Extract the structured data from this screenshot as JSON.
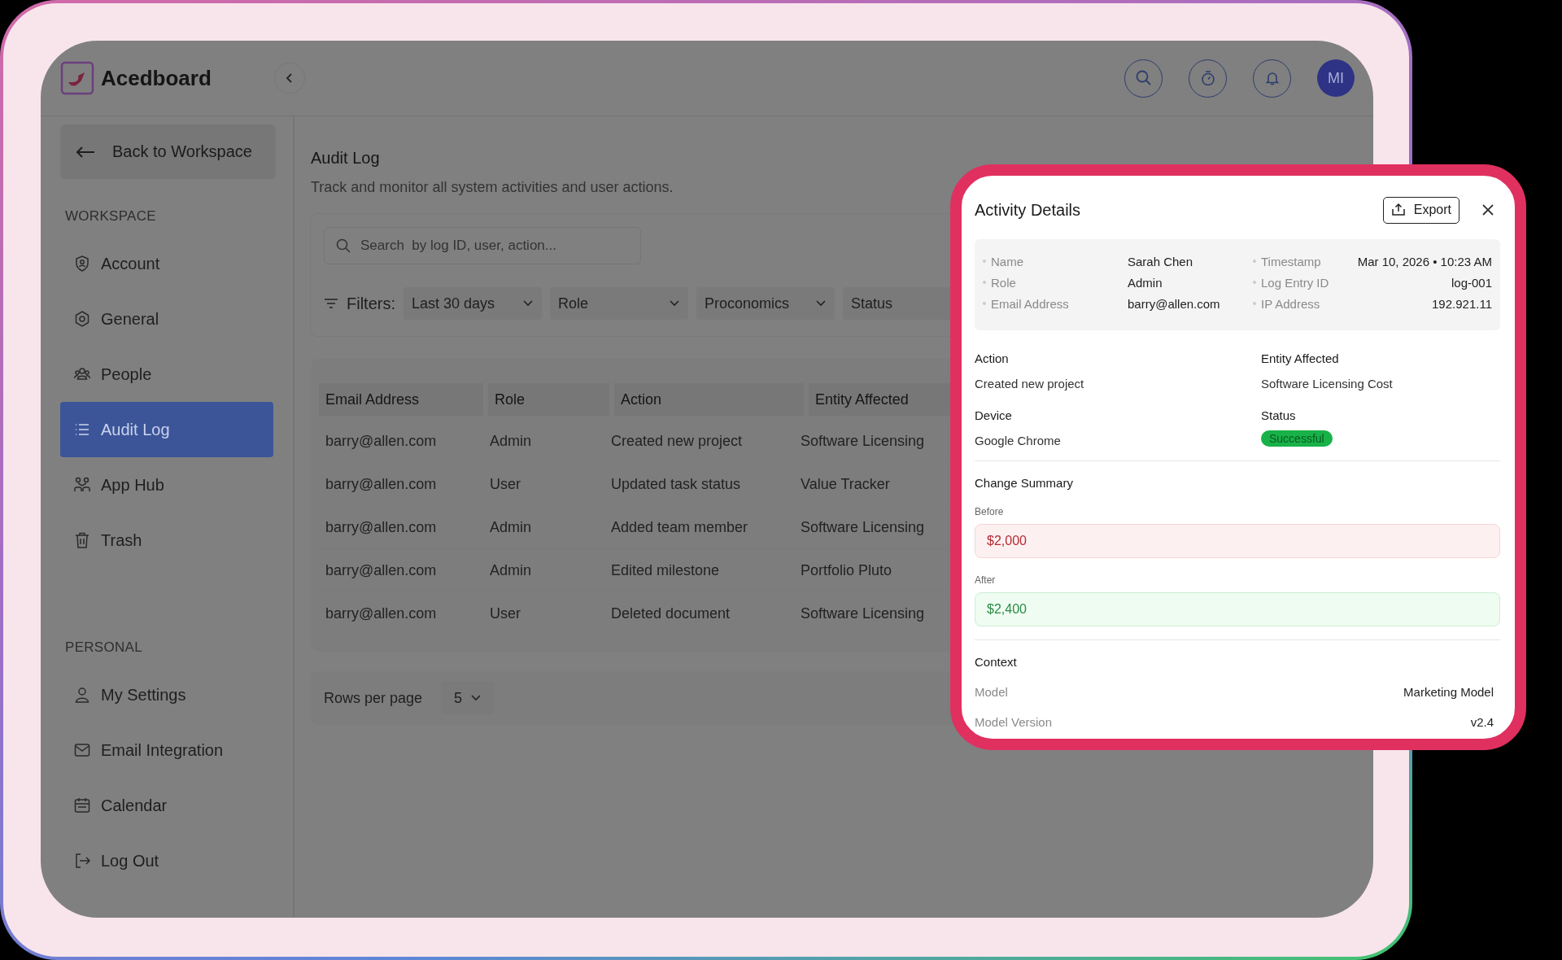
{
  "brand": {
    "name": "Acedboard"
  },
  "sidebar": {
    "back": "Back to Workspace",
    "sections": [
      {
        "title": "WORKSPACE",
        "items": [
          {
            "label": "Account",
            "kind": "shield",
            "selected": false
          },
          {
            "label": "General",
            "kind": "gear",
            "selected": false
          },
          {
            "label": "People",
            "kind": "people",
            "selected": false
          },
          {
            "label": "Audit Log",
            "kind": "list",
            "selected": true
          },
          {
            "label": "App Hub",
            "kind": "hub",
            "selected": false
          },
          {
            "label": "Trash",
            "kind": "trash",
            "selected": false
          }
        ]
      },
      {
        "title": "PERSONAL",
        "items": [
          {
            "label": "My Settings",
            "kind": "user",
            "selected": false
          },
          {
            "label": "Email Integration",
            "kind": "mail",
            "selected": false
          },
          {
            "label": "Calendar",
            "kind": "calendar",
            "selected": false
          },
          {
            "label": "Log Out",
            "kind": "logout",
            "selected": false
          }
        ]
      }
    ]
  },
  "header": {
    "avatar": "MI"
  },
  "page": {
    "title": "Audit Log",
    "subtitle": "Track and monitor all system activities and user actions.",
    "search": {
      "placeholder": "Search  by log ID, user, action..."
    },
    "filters_label": "Filters:",
    "filters": [
      "Last 30 days",
      "Role",
      "Proconomics",
      "Status"
    ]
  },
  "table": {
    "columns": [
      "Email Address",
      "Role",
      "Action",
      "Entity Affected"
    ],
    "rows": [
      [
        "barry@allen.com",
        "Admin",
        "Created new project",
        "Software Licensing"
      ],
      [
        "barry@allen.com",
        "User",
        "Updated task status",
        "Value Tracker"
      ],
      [
        "barry@allen.com",
        "Admin",
        "Added team member",
        "Software Licensing"
      ],
      [
        "barry@allen.com",
        "Admin",
        "Edited milestone",
        "Portfolio Pluto"
      ],
      [
        "barry@allen.com",
        "User",
        "Deleted document",
        "Software Licensing"
      ]
    ]
  },
  "pagination": {
    "label": "Rows per page",
    "value": "5"
  },
  "details": {
    "title": "Activity Details",
    "export": "Export",
    "info_left": [
      {
        "label": "Name",
        "value": "Sarah Chen"
      },
      {
        "label": "Role",
        "value": "Admin"
      },
      {
        "label": "Email Address",
        "value": "barry@allen.com"
      }
    ],
    "info_right": [
      {
        "label": "Timestamp",
        "value": "Mar 10, 2026 • 10:23 AM"
      },
      {
        "label": "Log Entry ID",
        "value": "log-001"
      },
      {
        "label": "IP Address",
        "value": "192.921.11"
      }
    ],
    "fields": [
      {
        "label": "Action",
        "value": "Created new project",
        "kind": "text"
      },
      {
        "label": "Entity Affected",
        "value": "Software Licensing Cost",
        "kind": "text"
      },
      {
        "label": "Device",
        "value": "Google Chrome",
        "kind": "text"
      },
      {
        "label": "Status",
        "value": "Successful",
        "kind": "badge"
      }
    ],
    "change": {
      "title": "Change Summary",
      "items": [
        {
          "label": "Before",
          "value": "$2,000",
          "kind": "old"
        },
        {
          "label": "After",
          "value": "$2,400",
          "kind": "new"
        }
      ]
    },
    "context": {
      "title": "Context",
      "rows": [
        {
          "label": "Model",
          "value": "Marketing Model"
        },
        {
          "label": "Model Version",
          "value": "v2.4"
        }
      ]
    }
  }
}
